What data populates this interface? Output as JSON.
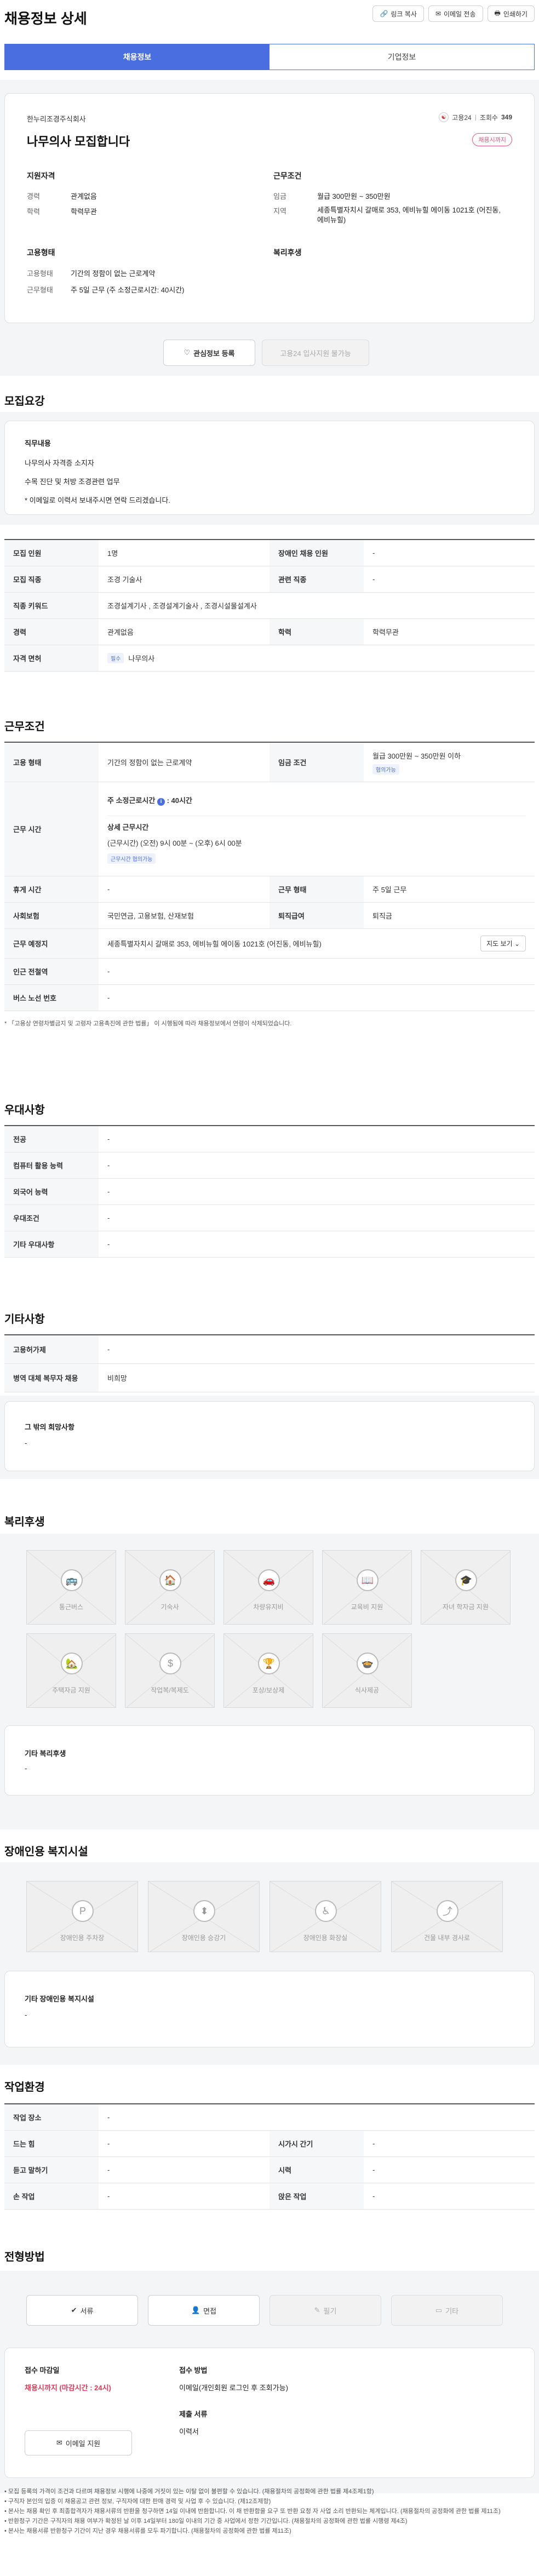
{
  "header": {
    "title": "채용정보 상세",
    "buttons": [
      "링크 복사",
      "이메일 전송",
      "인쇄하기"
    ]
  },
  "tabs": [
    "채용정보",
    "기업정보"
  ],
  "summary": {
    "company": "한누리조경주식회사",
    "headline": "나무의사 모집합니다",
    "agency": "고용24",
    "views_label": "조회수",
    "views": "349",
    "status_badge": "채용시까지",
    "qual_title": "지원자격",
    "qual": [
      {
        "k": "경력",
        "v": "관계없음"
      },
      {
        "k": "학력",
        "v": "학력무관"
      }
    ],
    "cond_title": "근무조건",
    "cond": [
      {
        "k": "임금",
        "v": "월급 300만원 ~ 350만원"
      },
      {
        "k": "지역",
        "v": "세종특별자치시 갈매로 353, 에비뉴힐 에이동 1021호 (어진동, 에비뉴힐)"
      }
    ],
    "emp_title": "고용형태",
    "emp": [
      {
        "k": "고용형태",
        "v": "기간의 정함이 없는 근로계약"
      },
      {
        "k": "근무형태",
        "v": "주 5일 근무 (주 소정근로시간: 40시간)"
      }
    ],
    "welfare_title": "복리후생"
  },
  "actions": {
    "interest": "관심정보 등록",
    "apply_unavailable": "고용24 입사지원 불가능"
  },
  "recruit": {
    "title": "모집요강",
    "duty_title": "직무내용",
    "duty_lines": [
      "나무의사 자격증 소지자",
      "수목 진단 및 처방 조경관련 업무",
      "* 이메일로 이력서 보내주시면 연락 드리겠습니다."
    ],
    "rows": [
      [
        {
          "k": "모집 인원",
          "v": "1명"
        },
        {
          "k": "장애인 채용 인원",
          "v": "-"
        }
      ],
      [
        {
          "k": "모집 직종",
          "v": "조경 기술사"
        },
        {
          "k": "관련 직종",
          "v": "-"
        }
      ],
      [
        {
          "k": "직종 키워드",
          "v": "조경설계기사 , 조경설계기술사 , 조경시설물설계사"
        }
      ],
      [
        {
          "k": "경력",
          "v": "관계없음"
        },
        {
          "k": "학력",
          "v": "학력무관"
        }
      ],
      [
        {
          "k": "자격 면허",
          "pill": "필수",
          "v": "나무의사"
        }
      ]
    ]
  },
  "conditions": {
    "title": "근무조건",
    "emp_k": "고용 형태",
    "emp_v": "기간의 정함이 없는 근로계약",
    "wage_k": "임금 조건",
    "wage_v": "월급 300만원 ~ 350만원 이하",
    "wage_badge": "협의가능",
    "time_k": "근무 시간",
    "weekly": "주 소정근로시간",
    "weekly_hours": ": 40시간",
    "detail_title": "상세 근무시간",
    "detail": "(근무시간) (오전) 9시 00분 ~ (오후) 6시 00분",
    "time_badge": "근무시간 협의가능",
    "rows": [
      [
        {
          "k": "휴게 시간",
          "v": "-"
        },
        {
          "k": "근무 형태",
          "v": "주 5일 근무"
        }
      ],
      [
        {
          "k": "사회보험",
          "v": "국민연금, 고용보험, 산재보험"
        },
        {
          "k": "퇴직급여",
          "v": "퇴직금"
        }
      ]
    ],
    "place_k": "근무 예정지",
    "place_v": "세종특별자치시 갈매로 353, 에비뉴힐 에이동 1021호 (어진동, 에비뉴힐)",
    "map_btn": "지도 보기",
    "rows2": [
      {
        "k": "인근 전철역",
        "v": "-"
      },
      {
        "k": "버스 노선 번호",
        "v": "-"
      }
    ],
    "note": "* 「고용상 연령차별금지 및 고령자 고용촉진에 관한 법률」 이 시행됨에 따라 채용정보에서 연령이 삭제되었습니다."
  },
  "preference": {
    "title": "우대사항",
    "rows": [
      {
        "k": "전공",
        "v": "-"
      },
      {
        "k": "컴퓨터 활용 능력",
        "v": "-"
      },
      {
        "k": "외국어 능력",
        "v": "-"
      },
      {
        "k": "우대조건",
        "v": "-"
      },
      {
        "k": "기타 우대사항",
        "v": "-"
      }
    ]
  },
  "etc": {
    "title": "기타사항",
    "rows": [
      {
        "k": "고용허가제",
        "v": "-"
      },
      {
        "k": "병역 대체 복무자 채용",
        "v": "비희망"
      }
    ],
    "box_title": "그 밖의 희망사항",
    "box_value": "-"
  },
  "welfare": {
    "title": "복리후생",
    "tiles": [
      "통근버스",
      "기숙사",
      "차량유지비",
      "교육비 지원",
      "자녀 학자금 지원",
      "주택자금 지원",
      "작업복/복제도",
      "포상/보상제",
      "식사제공"
    ],
    "box_title": "기타 복리후생",
    "box_value": "-"
  },
  "disabled": {
    "title": "장애인용 복지시설",
    "tiles": [
      "장애인용 주차장",
      "장애인용 승강기",
      "장애인용 화장실",
      "건물 내부 경사로"
    ],
    "box_title": "기타 장애인용 복지시설",
    "box_value": "-"
  },
  "work_env": {
    "title": "작업환경",
    "rows": [
      [
        {
          "k": "작업 장소",
          "v": "-"
        }
      ],
      [
        {
          "k": "드는 힘",
          "v": "-"
        },
        {
          "k": "시가시 간기",
          "v": "-"
        }
      ],
      [
        {
          "k": "듣고 말하기",
          "v": "-"
        },
        {
          "k": "시력",
          "v": "-"
        }
      ],
      [
        {
          "k": "손 작업",
          "v": "-"
        },
        {
          "k": "앉은 작업",
          "v": "-"
        }
      ]
    ]
  },
  "selection": {
    "title": "전형방법",
    "buttons": [
      "서류",
      "면접",
      "필기",
      "기타"
    ]
  },
  "apply": {
    "deadline_title": "접수 마감일",
    "deadline_value": "채용시까지 (마감시간 : 24시)",
    "email_btn": "이메일 지원",
    "method_title": "접수 방법",
    "method_value": "이메일(개인회원 로그인 후 조회가능)",
    "docs_title": "제출 서류",
    "docs_value": "이력서"
  },
  "footnotes": [
    "• 모집 등록의 가격이 조건과 다르며 채용정보 시행에 나중에 거짓이 있는 이탈 없이 불편할 수 있습니다. (채용절차의 공정화에 관한 법률 제4조제1항)",
    "• 구직자 본인의 입증 이 채용공고 관련 정보, 구직자에 대한 판매 경력 및 사업 후 수 있습니다. (제12조제항)",
    "• 본사는 채용 확인 후 최종합격자가 채용서류의 반환을 청구하면 14일 이내에 반환합니다. 이 채 반환함을 요구 또 반환 요청 자 사업 소리 반환되는 체계입니다. (채용절차의 공정화에 관한 법률 제11조)",
    "• 반환청구 기간은 구직자의 채용 여부가 확정된 날 이후 14일부터 180일 이내의 기간 중 사업에서 정한 기간입니다. (채용절차의 공정화에 관한 법률 시행령 제4조)",
    "• 본사는 채용서류 반환청구 기간이 지난 경우 채용서류를 모두 파기합니다. (채용절차의 공정화에 관한 법률 제11조)"
  ]
}
